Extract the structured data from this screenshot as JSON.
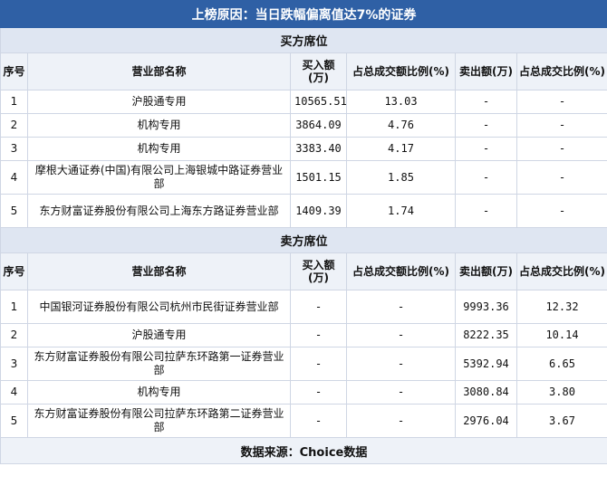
{
  "title": "上榜原因：当日跌幅偏离值达7%的证券",
  "buy_section": {
    "label": "买方席位",
    "headers": [
      "序号",
      "营业部名称",
      "买入额(万)",
      "占总成交额比例(%)",
      "卖出额(万)",
      "占总成交比例(%)"
    ],
    "rows": [
      {
        "idx": "1",
        "name": "沪股通专用",
        "buy": "10565.51",
        "buy_pct": "13.03",
        "sell": "-",
        "sell_pct": "-"
      },
      {
        "idx": "2",
        "name": "机构专用",
        "buy": "3864.09",
        "buy_pct": "4.76",
        "sell": "-",
        "sell_pct": "-"
      },
      {
        "idx": "3",
        "name": "机构专用",
        "buy": "3383.40",
        "buy_pct": "4.17",
        "sell": "-",
        "sell_pct": "-"
      },
      {
        "idx": "4",
        "name": "摩根大通证券(中国)有限公司上海银城中路证券营业部",
        "buy": "1501.15",
        "buy_pct": "1.85",
        "sell": "-",
        "sell_pct": "-"
      },
      {
        "idx": "5",
        "name": "东方财富证券股份有限公司上海东方路证券营业部",
        "buy": "1409.39",
        "buy_pct": "1.74",
        "sell": "-",
        "sell_pct": "-"
      }
    ]
  },
  "sell_section": {
    "label": "卖方席位",
    "headers": [
      "序号",
      "营业部名称",
      "买入额(万)",
      "占总成交额比例(%)",
      "卖出额(万)",
      "占总成交比例(%)"
    ],
    "rows": [
      {
        "idx": "1",
        "name": "中国银河证券股份有限公司杭州市民街证券营业部",
        "buy": "-",
        "buy_pct": "-",
        "sell": "9993.36",
        "sell_pct": "12.32"
      },
      {
        "idx": "2",
        "name": "沪股通专用",
        "buy": "-",
        "buy_pct": "-",
        "sell": "8222.35",
        "sell_pct": "10.14"
      },
      {
        "idx": "3",
        "name": "东方财富证券股份有限公司拉萨东环路第一证券营业部",
        "buy": "-",
        "buy_pct": "-",
        "sell": "5392.94",
        "sell_pct": "6.65"
      },
      {
        "idx": "4",
        "name": "机构专用",
        "buy": "-",
        "buy_pct": "-",
        "sell": "3080.84",
        "sell_pct": "3.80"
      },
      {
        "idx": "5",
        "name": "东方财富证券股份有限公司拉萨东环路第二证券营业部",
        "buy": "-",
        "buy_pct": "-",
        "sell": "2976.04",
        "sell_pct": "3.67"
      }
    ]
  },
  "footer": "数据来源：Choice数据"
}
